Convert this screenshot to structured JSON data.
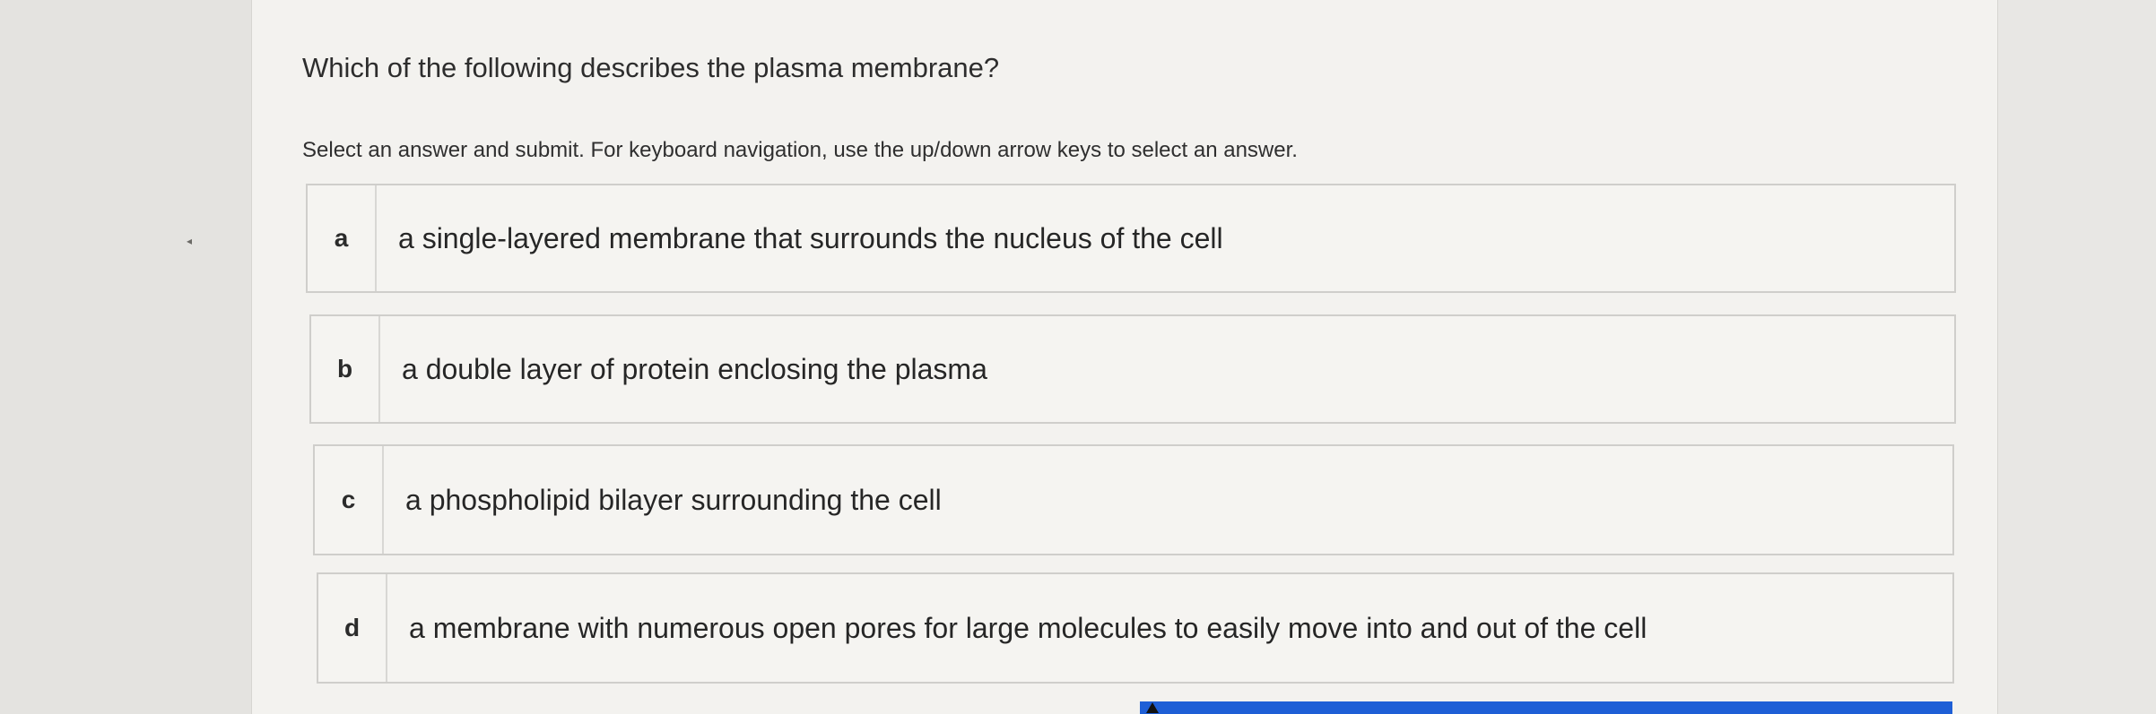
{
  "question": {
    "title": "Which of the following describes the plasma membrane?",
    "instructions": "Select an answer and submit. For keyboard navigation, use the up/down arrow keys to select an answer."
  },
  "options": [
    {
      "letter": "a",
      "text": "a single-layered membrane that surrounds the nucleus of the cell"
    },
    {
      "letter": "b",
      "text": "a double layer of protein enclosing the plasma"
    },
    {
      "letter": "c",
      "text": "a phospholipid bilayer surrounding the cell"
    },
    {
      "letter": "d",
      "text": "a membrane with numerous open pores for large molecules to easily move into and out of the cell"
    }
  ],
  "colors": {
    "page_background": "#e7e6e3",
    "panel_background": "#f3f2ef",
    "option_border": "#cfcecb",
    "submit_accent": "#1e5fd6"
  }
}
